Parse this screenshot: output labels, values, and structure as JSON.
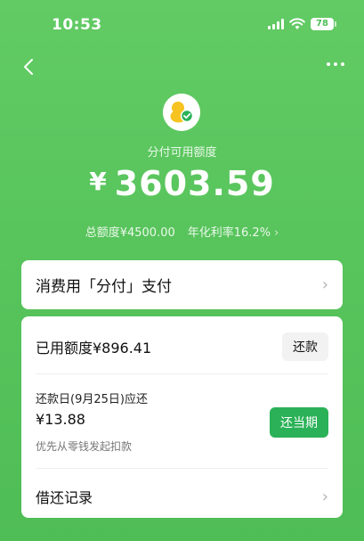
{
  "status_bar": {
    "time": "10:53",
    "battery": "78"
  },
  "header": {
    "available_label": "分付可用额度",
    "currency": "¥",
    "available_amount": "3603.59"
  },
  "summary": {
    "total_limit": "总额度¥4500.00",
    "annual_rate": "年化利率16.2%",
    "rate_chevron": "›"
  },
  "pay_card": {
    "title": "消费用「分付」支付",
    "chevron": "›"
  },
  "main_card": {
    "used_text": "已用额度¥896.41",
    "repay_button": "还款",
    "due_title": "还款日(9月25日)应还",
    "due_amount": "¥13.88",
    "due_note": "优先从零钱发起扣款",
    "repay_now_button": "还当期",
    "records_label": "借还记录",
    "records_chevron": "›"
  },
  "colors": {
    "brand_green": "#4fbd56",
    "button_green": "#2bb157",
    "logo_yellow": "#f6c320"
  }
}
